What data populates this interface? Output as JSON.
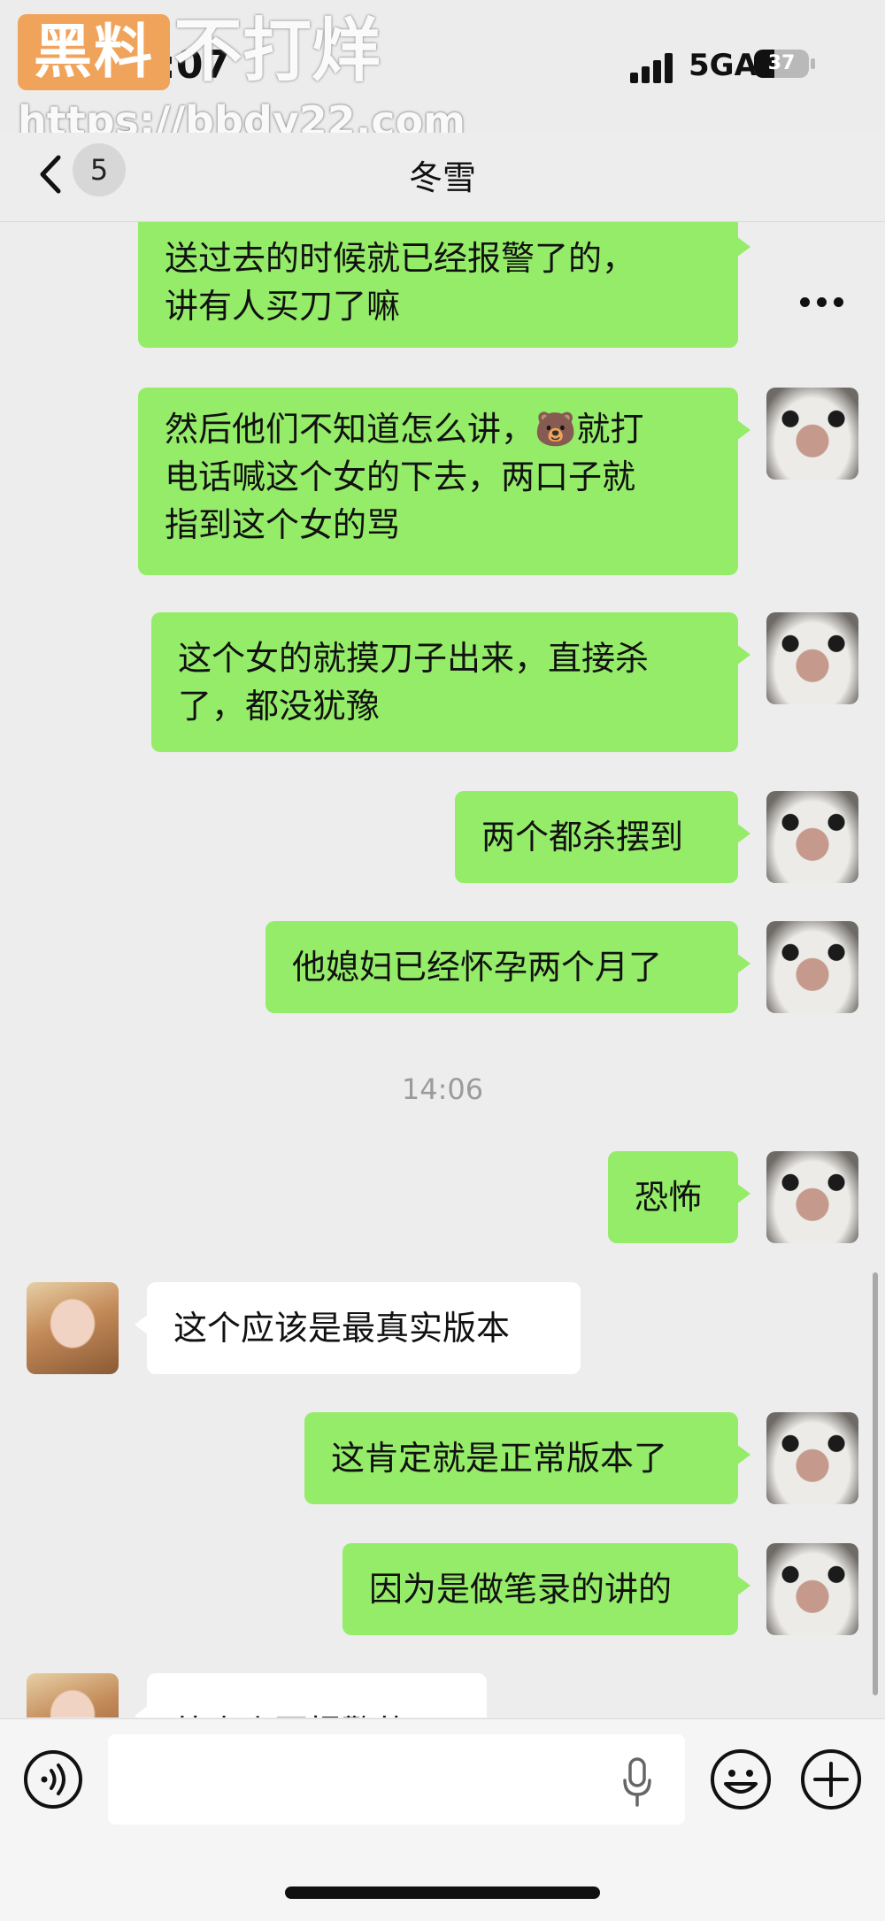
{
  "watermark": {
    "badge_text": "黑料",
    "slogan": "不打烊",
    "url": "https://bbdy22.com"
  },
  "status_bar": {
    "time": "14:07",
    "network": "5GA",
    "battery": "37",
    "battery_level": 0.37
  },
  "header": {
    "back_count": "5",
    "title": "冬雪"
  },
  "messages": [
    {
      "side": "out",
      "lines": [
        "送过去的时候就已经报警了的，",
        "讲有人买刀了嘛"
      ]
    },
    {
      "side": "out",
      "lines": [
        "然后他们不知道怎么讲，🐻就打",
        "电话喊这个女的下去，两口子就",
        "指到这个女的骂"
      ]
    },
    {
      "side": "out",
      "lines": [
        "这个女的就摸刀子出来，直接杀",
        "了，都没犹豫"
      ]
    },
    {
      "side": "out",
      "lines": [
        "两个都杀摆到"
      ]
    },
    {
      "side": "out",
      "lines": [
        "他媳妇已经怀孕两个月了"
      ]
    },
    {
      "side": "out",
      "lines": [
        "恐怖"
      ]
    },
    {
      "side": "in",
      "lines": [
        "这个应该是最真实版本"
      ]
    },
    {
      "side": "out",
      "lines": [
        "这肯定就是正常版本了"
      ]
    },
    {
      "side": "out",
      "lines": [
        "因为是做笔录的讲的"
      ]
    },
    {
      "side": "in",
      "lines": [
        "外卖小哥报警的?"
      ]
    }
  ],
  "timestamp": "14:06",
  "input": {
    "value": ""
  },
  "colors": {
    "out_bubble": "#95ec69",
    "in_bubble": "#ffffff",
    "background": "#ededed"
  }
}
